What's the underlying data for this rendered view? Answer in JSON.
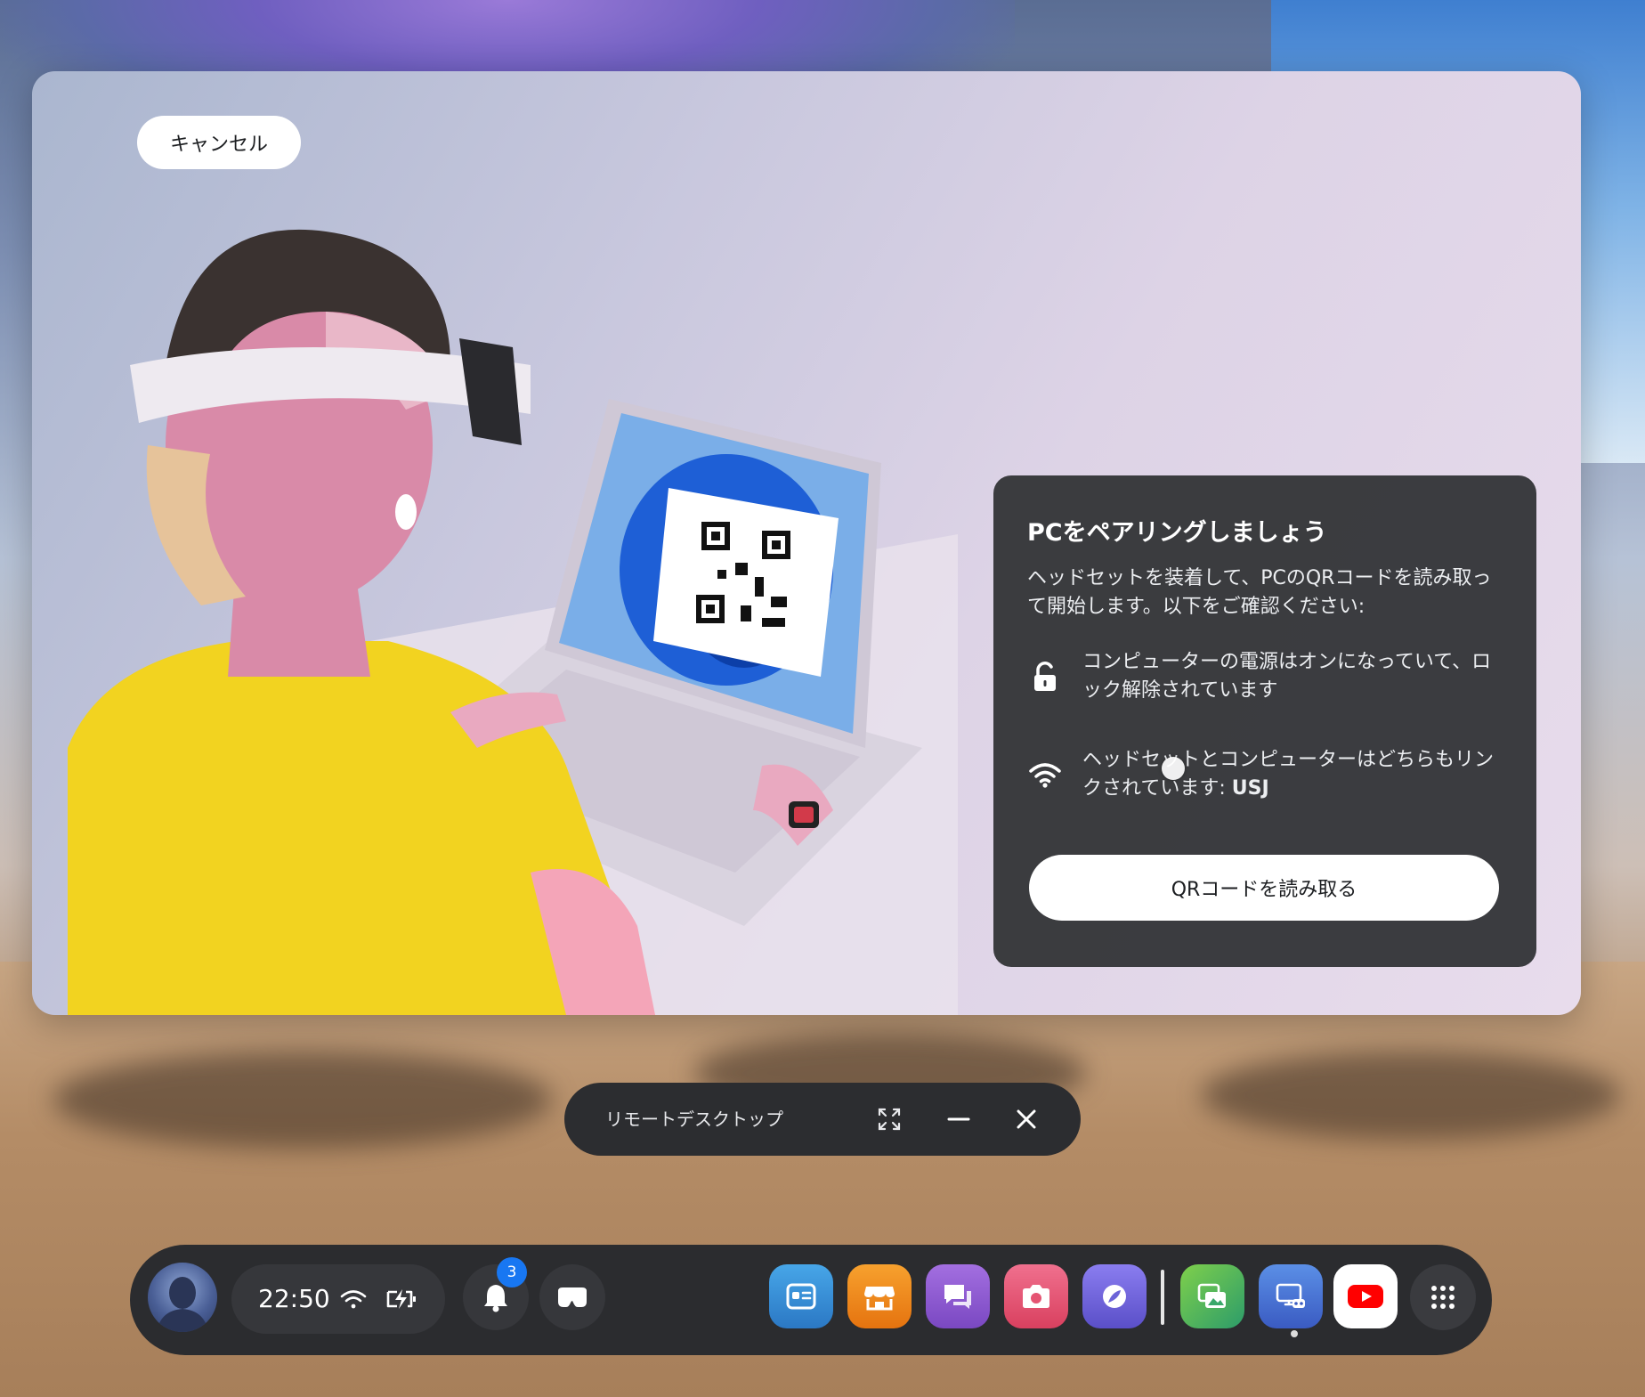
{
  "panel": {
    "cancel_label": "キャンセル",
    "info": {
      "title": "PCをペアリングしましょう",
      "description": "ヘッドセットを装着して、PCのQRコードを読み取って開始します。以下をご確認ください:",
      "requirements": [
        {
          "icon": "unlock-icon",
          "text": "コンピューターの電源はオンになっていて、ロック解除されています"
        },
        {
          "icon": "wifi-icon",
          "text_prefix": "ヘッドセットとコンピューターはどちらもリンクされています: ",
          "network": "USJ"
        }
      ],
      "scan_button_label": "QRコードを読み取る"
    }
  },
  "window_bar": {
    "title": "リモートデスクトップ",
    "buttons": [
      "fullscreen-icon",
      "minimize-icon",
      "close-icon"
    ]
  },
  "taskbar": {
    "time": "22:50",
    "notifications_count": "3",
    "status_icons": [
      "wifi-icon",
      "battery-charging-icon"
    ],
    "apps": [
      {
        "name": "app-library",
        "color": "#3a8fd6"
      },
      {
        "name": "store",
        "color": "#f08a1c"
      },
      {
        "name": "chat",
        "color": "#8d5fd0"
      },
      {
        "name": "camera",
        "color": "#e85577"
      },
      {
        "name": "explore",
        "color": "#6c64d8"
      },
      {
        "name": "gallery",
        "color": "#4caf50"
      },
      {
        "name": "remote-desktop",
        "color": "#4a73d8"
      },
      {
        "name": "youtube",
        "color": "#ffffff"
      }
    ]
  }
}
